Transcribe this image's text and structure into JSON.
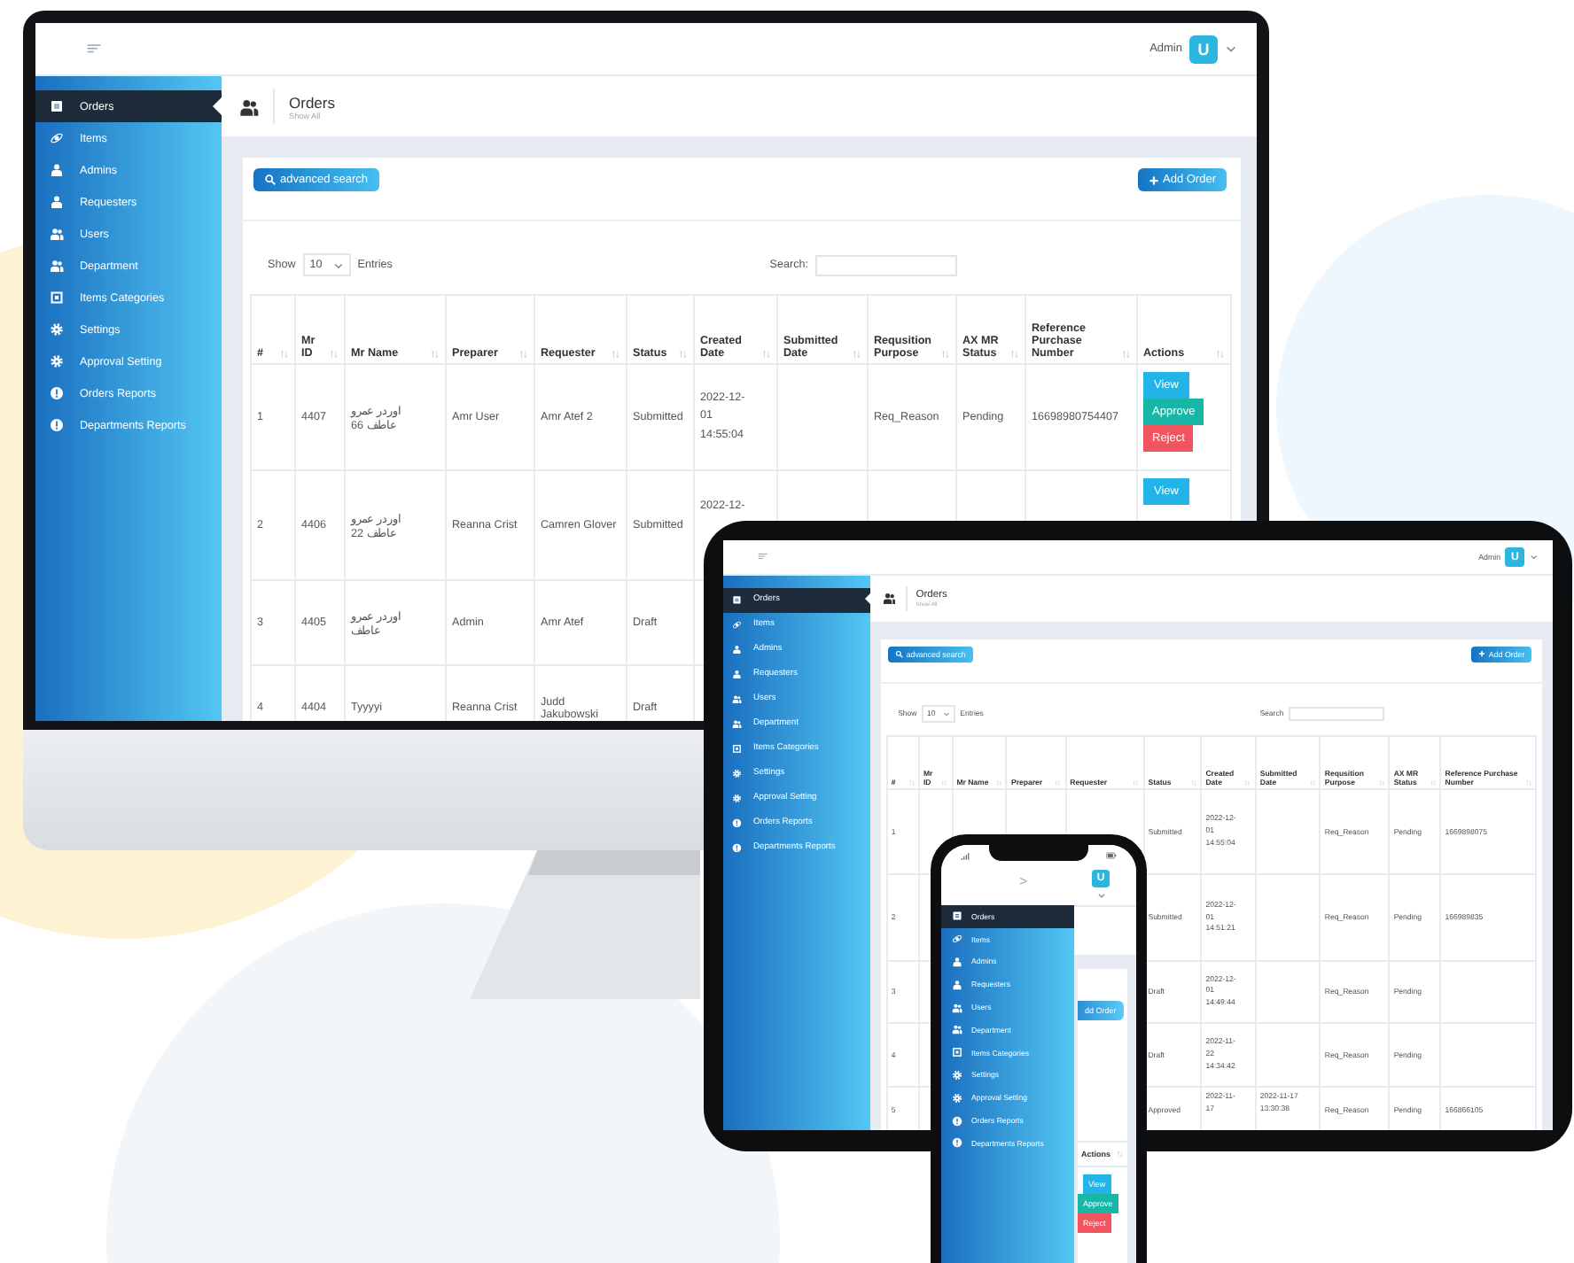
{
  "monitor": {
    "topbar": {
      "user_name": "Admin",
      "avatar_letter": "U"
    },
    "sidebar": {
      "items": [
        {
          "label": "Orders",
          "selected": true
        },
        {
          "label": "Items",
          "selected": false
        },
        {
          "label": "Admins",
          "selected": false
        },
        {
          "label": "Requesters",
          "selected": false
        },
        {
          "label": "Users",
          "selected": false
        },
        {
          "label": "Department",
          "selected": false
        },
        {
          "label": "Items Categories",
          "selected": false
        },
        {
          "label": "Settings",
          "selected": false
        },
        {
          "label": "Approval Setting",
          "selected": false
        },
        {
          "label": "Orders Reports",
          "selected": false
        },
        {
          "label": "Departments Reports",
          "selected": false
        }
      ]
    },
    "page_header": {
      "title": "Orders",
      "subtitle": "Show All"
    },
    "card": {
      "search_button": "advanced search",
      "add_button": "Add Order"
    },
    "table_controls": {
      "show_label": "Show",
      "page_size": "10",
      "entries_label": "Entries",
      "search_label": "Search:"
    },
    "table": {
      "columns": [
        "#",
        "Mr ID",
        "Mr Name",
        "Preparer",
        "Requester",
        "Status",
        "Created Date",
        "Submitted Date",
        "Requsition Purpose",
        "AX MR Status",
        "Reference Purchase Number",
        "Actions"
      ],
      "rows": [
        {
          "number": "1",
          "mr_id": "4407",
          "mr_name": "اوردر عمرو عاطف 66",
          "preparer": "Amr User",
          "requester": "Amr Atef 2",
          "status": "Submitted",
          "created_date": "2022-12-01 14:55:04",
          "requisition_purpose": "Req_Reason",
          "ax_mr_status": "Pending",
          "reference_purchase_number": "16698980754407",
          "actions": [
            {
              "label": "View",
              "kind": "view"
            },
            {
              "label": "Approve",
              "kind": "approve"
            },
            {
              "label": "Reject",
              "kind": "reject"
            }
          ]
        },
        {
          "number": "2",
          "mr_id": "4406",
          "mr_name": "اوردر عمرو عاطف 22",
          "preparer": "Reanna Crist",
          "requester": "Camren Glover",
          "status": "Submitted",
          "created_date": "2022-12-",
          "actions": [
            {
              "label": "View",
              "kind": "view"
            }
          ]
        },
        {
          "number": "3",
          "mr_id": "4405",
          "mr_name": "اوردر عمرو عاطف",
          "preparer": "Admin",
          "requester": "Amr Atef",
          "status": "Draft"
        },
        {
          "number": "4",
          "mr_id": "4404",
          "mr_name": "Tyyyyi",
          "preparer": "Reanna Crist",
          "requester": "Judd Jakubowski",
          "status": "Draft"
        }
      ]
    }
  },
  "tablet": {
    "topbar": {
      "user_name": "Admin",
      "avatar_letter": "U"
    },
    "sidebar": {
      "items": [
        {
          "label": "Orders",
          "selected": true
        },
        {
          "label": "Items",
          "selected": false
        },
        {
          "label": "Admins",
          "selected": false
        },
        {
          "label": "Requesters",
          "selected": false
        },
        {
          "label": "Users",
          "selected": false
        },
        {
          "label": "Department",
          "selected": false
        },
        {
          "label": "Items Categories",
          "selected": false
        },
        {
          "label": "Settings",
          "selected": false
        },
        {
          "label": "Approval Setting",
          "selected": false
        },
        {
          "label": "Orders Reports",
          "selected": false
        },
        {
          "label": "Departments Reports",
          "selected": false
        }
      ]
    },
    "page_header": {
      "title": "Orders",
      "subtitle": "Show All"
    },
    "card": {
      "search_button": "advanced search",
      "add_button": "Add Order"
    },
    "table_controls": {
      "show_label": "Show",
      "page_size": "10",
      "entries_label": "Entries",
      "search_label": "Search"
    },
    "table": {
      "columns": [
        "#",
        "Mr ID",
        "Mr Name",
        "Preparer",
        "Requester",
        "Status",
        "Created Date",
        "Submitted Date",
        "Requsition Purpose",
        "AX MR Status",
        "Reference Purchase Number"
      ],
      "rows": [
        {
          "number": "1",
          "status": "Submitted",
          "created_date": "2022-12-01 14:55:04",
          "requisition_purpose": "Req_Reason",
          "ax_mr_status": "Pending",
          "reference_purchase_number": "1669898075"
        },
        {
          "number": "2",
          "status": "Submitted",
          "created_date": "2022-12-01 14:51:21",
          "requisition_purpose": "Req_Reason",
          "ax_mr_status": "Pending",
          "reference_purchase_number": "166989835"
        },
        {
          "number": "3",
          "status": "Draft",
          "created_date": "2022-12-01 14:49:44",
          "requisition_purpose": "Req_Reason",
          "ax_mr_status": "Pending"
        },
        {
          "number": "4",
          "status": "Draft",
          "created_date": "2022-11-22 14:34:42",
          "requisition_purpose": "Req_Reason",
          "ax_mr_status": "Pending"
        },
        {
          "number": "5",
          "status": "Approved",
          "created_date": "2022-11-17",
          "submitted_date": "2022-11-17 13:30:38",
          "requisition_purpose": "Req_Reason",
          "ax_mr_status": "Pending",
          "reference_purchase_number": "166866105"
        }
      ]
    }
  },
  "phone": {
    "topbar": {
      "back_glyph": ">",
      "avatar_letter": "U"
    },
    "sidebar": {
      "items": [
        {
          "label": "Orders",
          "selected": true
        },
        {
          "label": "Items",
          "selected": false
        },
        {
          "label": "Admins",
          "selected": false
        },
        {
          "label": "Requesters",
          "selected": false
        },
        {
          "label": "Users",
          "selected": false
        },
        {
          "label": "Department",
          "selected": false
        },
        {
          "label": "Items Categories",
          "selected": false
        },
        {
          "label": "Settings",
          "selected": false
        },
        {
          "label": "Approval Setting",
          "selected": false
        },
        {
          "label": "Orders Reports",
          "selected": false
        },
        {
          "label": "Departments Reports",
          "selected": false
        }
      ]
    },
    "card": {
      "add_button": "dd Order"
    },
    "table": {
      "columns": [
        "Actions"
      ],
      "rows": [
        {
          "actions": [
            {
              "label": "View",
              "kind": "view"
            },
            {
              "label": "Approve",
              "kind": "approve"
            },
            {
              "label": "Reject",
              "kind": "reject"
            }
          ]
        }
      ]
    }
  }
}
